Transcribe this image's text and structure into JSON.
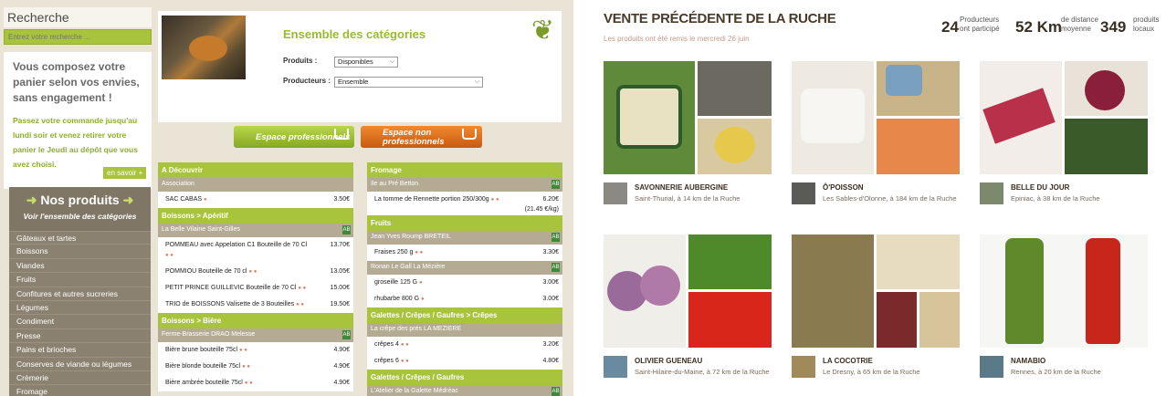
{
  "left": {
    "sidebar": {
      "title": "Recherche",
      "search_placeholder": "Entrez votre recherche ...",
      "promo_title": "Vous composez votre panier selon vos envies, sans engagement !",
      "promo_text": "Passez votre commande jusqu'au lundi soir et venez retirer votre panier le Jeudi au dépôt que vous avez choisi.",
      "more_label": "en savoir +",
      "products_title": "Nos produits",
      "products_sub": "Voir l'ensemble des catégories",
      "products_items": [
        "Gâteaux et tartes",
        "Boissons",
        "Viandes",
        "Fruits",
        "Confitures et autres sucreries",
        "Légumes",
        "Condiment",
        "Presse",
        "Pains et brioches",
        "Conserves de viande ou légumes",
        "Crèmerie",
        "Fromage"
      ]
    },
    "categories": {
      "title": "Ensemble des catégories",
      "produits_label": "Produits :",
      "produits_value": "Disponibles",
      "producteurs_label": "Producteurs :",
      "producteurs_value": "Ensemble"
    },
    "buttons": {
      "pro": "Espace professionnels",
      "non_pro": "Espace non professionnels"
    },
    "table_left": {
      "cat1": "A Découvrir",
      "prod1": "Association",
      "item1": {
        "name": "SAC CABAS",
        "price": "3.50€"
      },
      "cat2": "Boissons > Apéritif",
      "prod2": "La Belle Vilaine Saint-Gilles",
      "item2": {
        "name": "POMMEAU avec Appelation C1 Bouteille de 70 Cl",
        "price": "13.70€"
      },
      "item3": {
        "name": "POMMIOU Bouteille de 70 cl",
        "price": "13.05€"
      },
      "item4": {
        "name": "PETIT PRINCE GUILLEVIC Bouteille de 70 Cl",
        "price": "15.00€"
      },
      "item5": {
        "name": "TRIO de BOISSONS Valisette de 3 Bouteilles",
        "price": "19.50€"
      },
      "cat3": "Boissons > Bière",
      "prod3": "Ferme-Brasserie DRAO Melesse",
      "item6": {
        "name": "Bière brune bouteille 75cl",
        "price": "4.90€"
      },
      "item7": {
        "name": "Bière blonde bouteille 75cl",
        "price": "4.90€"
      },
      "item8": {
        "name": "Bière ambrée bouteille 75cl",
        "price": "4.90€"
      }
    },
    "table_right": {
      "cat1": "Fromage",
      "prod1": "Ile au Pré Betton",
      "item1": {
        "name": "La tomme de Rennette portion 250/300g",
        "price": "6.20€",
        "unit": "(21.45 €/kg)"
      },
      "cat2": "Fruits",
      "prod2": "Jean Yves Roump BRETEIL",
      "item2": {
        "name": "Fraises 250 g",
        "price": "3.30€"
      },
      "prod3": "Ronan Le Gall La Mézière",
      "item3": {
        "name": "groseille 125 G",
        "price": "3.00€"
      },
      "item4": {
        "name": "rhubarbe 800 G",
        "price": "3.00€"
      },
      "cat3": "Galettes / Crêpes / Gaufres > Crêpes",
      "prod4": "La crêpe des prés LA MEZIERE",
      "item5": {
        "name": "crêpes 4",
        "price": "3.20€"
      },
      "item6": {
        "name": "crêpes 6",
        "price": "4.80€"
      },
      "cat4": "Galettes / Crêpes / Gaufres",
      "prod5": "L'Atelier de la Galette Médréac"
    },
    "colors": {
      "green": "#a8c33c",
      "orange": "#e07a20",
      "taupe": "#8a8170"
    }
  },
  "right": {
    "title": "VENTE PRÉCÉDENTE DE LA RUCHE",
    "date": "Les produits ont été remis le mercredi 26 juin",
    "stats": {
      "producers_num": "24",
      "producers_l1": "Producteurs",
      "producers_l2": "ont participé",
      "distance_num": "52 Km",
      "distance_l1": "de distance",
      "distance_l2": "moyenne",
      "products_num": "349",
      "products_l1": "produits",
      "products_l2": "locaux"
    },
    "producers": [
      {
        "name": "SAVONNERIE AUBERGINE",
        "place": "Saint-Thurial, à 14 km de la Ruche",
        "image": "soap-jar-photo"
      },
      {
        "name": "Ô'POISSON",
        "place": "Les Sables-d'Olonne, à 184 km de la Ruche",
        "image": "fish-photo"
      },
      {
        "name": "BELLE DU JOUR",
        "place": "Epiniac, à 38 km de la Ruche",
        "image": "beetroot-photo"
      },
      {
        "name": "OLIVIER GUENEAU",
        "place": "Saint-Hilaire-du-Maine, à 72 km de la Ruche",
        "image": "turnip-tomato-photo"
      },
      {
        "name": "LA COCOTRIE",
        "place": "Le Dresny, à 65 km de la Ruche",
        "image": "beans-photo"
      },
      {
        "name": "NAMABIO",
        "place": "Rennes, à 20 km de la Ruche",
        "image": "juice-bottle-photo"
      }
    ]
  }
}
